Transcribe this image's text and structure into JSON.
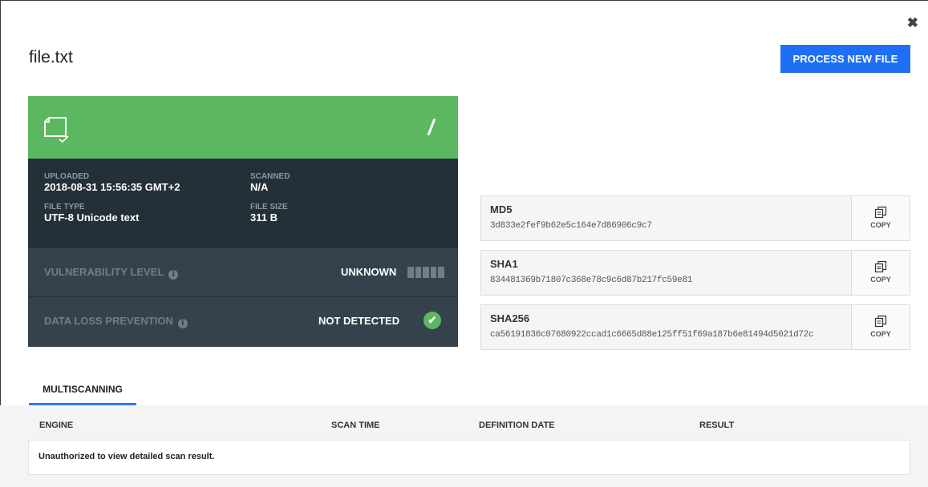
{
  "dialog": {
    "close_glyph": "✖"
  },
  "file": {
    "name": "file.txt"
  },
  "actions": {
    "process_new_file": "PROCESS NEW FILE"
  },
  "status_card": {
    "head_color": "#5cb860",
    "head_text": "/",
    "icon": "document-check-icon",
    "uploaded_label": "UPLOADED",
    "uploaded_value": "2018-08-31 15:56:35 GMT+2",
    "scanned_label": "SCANNED",
    "scanned_value": "N/A",
    "file_type_label": "FILE TYPE",
    "file_type_value": "UTF-8 Unicode text",
    "file_size_label": "FILE SIZE",
    "file_size_value": "311 B",
    "vulnerability_label": "VULNERABILITY LEVEL",
    "vulnerability_value": "UNKNOWN",
    "dlp_label": "DATA LOSS PREVENTION",
    "dlp_value": "NOT DETECTED",
    "info_glyph": "i",
    "check_glyph": "✔"
  },
  "hashes": [
    {
      "name": "MD5",
      "value": "3d833e2fef9b62e5c164e7d86906c9c7",
      "copy_label": "COPY"
    },
    {
      "name": "SHA1",
      "value": "834481369b71807c368e78c9c6d87b217fc59e81",
      "copy_label": "COPY"
    },
    {
      "name": "SHA256",
      "value": "ca56191836c07680922ccad1c6665d88e125ff51f69a187b6e81494d5021d72c",
      "copy_label": "COPY"
    }
  ],
  "tabs": [
    {
      "label": "MULTISCANNING",
      "active": true
    }
  ],
  "scan_table": {
    "columns": [
      "ENGINE",
      "SCAN TIME",
      "DEFINITION DATE",
      "RESULT"
    ],
    "empty_message": "Unauthorized to view detailed scan result."
  },
  "colors": {
    "accent": "#1e6ff3",
    "success": "#5cb860",
    "card_bg": "#2a353d"
  }
}
